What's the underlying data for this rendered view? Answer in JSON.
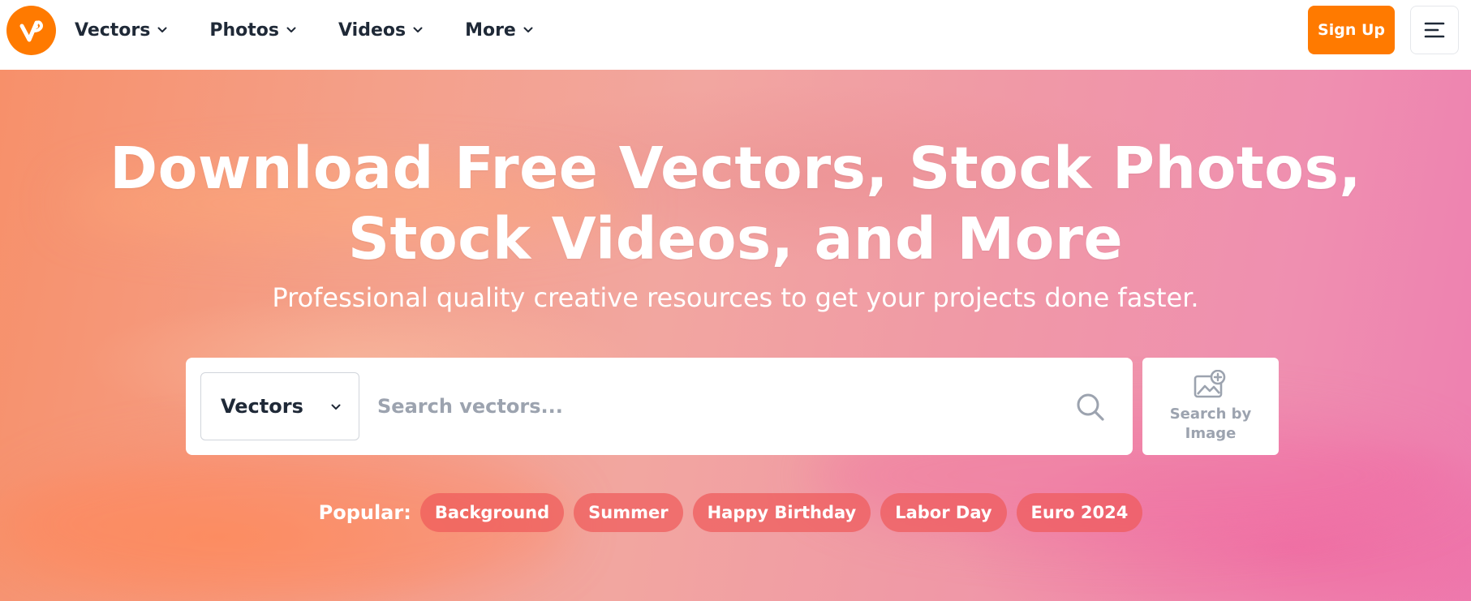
{
  "brand": {
    "logo_letter": "v",
    "accent_color": "#ff7a00"
  },
  "nav": {
    "items": [
      {
        "label": "Vectors"
      },
      {
        "label": "Photos"
      },
      {
        "label": "Videos"
      },
      {
        "label": "More"
      }
    ],
    "signup_label": "Sign Up",
    "menu_icon": "hamburger-menu-icon"
  },
  "hero": {
    "headline_line1": "Download Free Vectors, Stock Photos,",
    "headline_line2": "Stock Videos, and More",
    "subheadline": "Professional quality creative resources to get your projects done faster."
  },
  "search": {
    "type_selected": "Vectors",
    "placeholder": "Search vectors...",
    "value": "",
    "search_icon": "magnifier-icon",
    "image_search_label": "Search by Image",
    "image_search_icon": "image-add-icon"
  },
  "popular": {
    "label": "Popular:",
    "tags": [
      "Background",
      "Summer",
      "Happy Birthday",
      "Labor Day",
      "Euro 2024"
    ],
    "chip_color": "#ef5a5a"
  }
}
